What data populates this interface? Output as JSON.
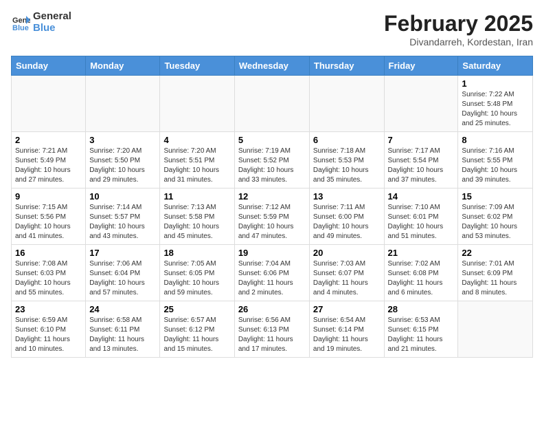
{
  "header": {
    "logo": {
      "general": "General",
      "blue": "Blue"
    },
    "title": "February 2025",
    "subtitle": "Divandarreh, Kordestan, Iran"
  },
  "calendar": {
    "days_of_week": [
      "Sunday",
      "Monday",
      "Tuesday",
      "Wednesday",
      "Thursday",
      "Friday",
      "Saturday"
    ],
    "weeks": [
      [
        {
          "day": "",
          "empty": true
        },
        {
          "day": "",
          "empty": true
        },
        {
          "day": "",
          "empty": true
        },
        {
          "day": "",
          "empty": true
        },
        {
          "day": "",
          "empty": true
        },
        {
          "day": "",
          "empty": true
        },
        {
          "day": "1",
          "sunrise": "7:22 AM",
          "sunset": "5:48 PM",
          "daylight": "10 hours and 25 minutes."
        }
      ],
      [
        {
          "day": "2",
          "sunrise": "7:21 AM",
          "sunset": "5:49 PM",
          "daylight": "10 hours and 27 minutes."
        },
        {
          "day": "3",
          "sunrise": "7:20 AM",
          "sunset": "5:50 PM",
          "daylight": "10 hours and 29 minutes."
        },
        {
          "day": "4",
          "sunrise": "7:20 AM",
          "sunset": "5:51 PM",
          "daylight": "10 hours and 31 minutes."
        },
        {
          "day": "5",
          "sunrise": "7:19 AM",
          "sunset": "5:52 PM",
          "daylight": "10 hours and 33 minutes."
        },
        {
          "day": "6",
          "sunrise": "7:18 AM",
          "sunset": "5:53 PM",
          "daylight": "10 hours and 35 minutes."
        },
        {
          "day": "7",
          "sunrise": "7:17 AM",
          "sunset": "5:54 PM",
          "daylight": "10 hours and 37 minutes."
        },
        {
          "day": "8",
          "sunrise": "7:16 AM",
          "sunset": "5:55 PM",
          "daylight": "10 hours and 39 minutes."
        }
      ],
      [
        {
          "day": "9",
          "sunrise": "7:15 AM",
          "sunset": "5:56 PM",
          "daylight": "10 hours and 41 minutes."
        },
        {
          "day": "10",
          "sunrise": "7:14 AM",
          "sunset": "5:57 PM",
          "daylight": "10 hours and 43 minutes."
        },
        {
          "day": "11",
          "sunrise": "7:13 AM",
          "sunset": "5:58 PM",
          "daylight": "10 hours and 45 minutes."
        },
        {
          "day": "12",
          "sunrise": "7:12 AM",
          "sunset": "5:59 PM",
          "daylight": "10 hours and 47 minutes."
        },
        {
          "day": "13",
          "sunrise": "7:11 AM",
          "sunset": "6:00 PM",
          "daylight": "10 hours and 49 minutes."
        },
        {
          "day": "14",
          "sunrise": "7:10 AM",
          "sunset": "6:01 PM",
          "daylight": "10 hours and 51 minutes."
        },
        {
          "day": "15",
          "sunrise": "7:09 AM",
          "sunset": "6:02 PM",
          "daylight": "10 hours and 53 minutes."
        }
      ],
      [
        {
          "day": "16",
          "sunrise": "7:08 AM",
          "sunset": "6:03 PM",
          "daylight": "10 hours and 55 minutes."
        },
        {
          "day": "17",
          "sunrise": "7:06 AM",
          "sunset": "6:04 PM",
          "daylight": "10 hours and 57 minutes."
        },
        {
          "day": "18",
          "sunrise": "7:05 AM",
          "sunset": "6:05 PM",
          "daylight": "10 hours and 59 minutes."
        },
        {
          "day": "19",
          "sunrise": "7:04 AM",
          "sunset": "6:06 PM",
          "daylight": "11 hours and 2 minutes."
        },
        {
          "day": "20",
          "sunrise": "7:03 AM",
          "sunset": "6:07 PM",
          "daylight": "11 hours and 4 minutes."
        },
        {
          "day": "21",
          "sunrise": "7:02 AM",
          "sunset": "6:08 PM",
          "daylight": "11 hours and 6 minutes."
        },
        {
          "day": "22",
          "sunrise": "7:01 AM",
          "sunset": "6:09 PM",
          "daylight": "11 hours and 8 minutes."
        }
      ],
      [
        {
          "day": "23",
          "sunrise": "6:59 AM",
          "sunset": "6:10 PM",
          "daylight": "11 hours and 10 minutes."
        },
        {
          "day": "24",
          "sunrise": "6:58 AM",
          "sunset": "6:11 PM",
          "daylight": "11 hours and 13 minutes."
        },
        {
          "day": "25",
          "sunrise": "6:57 AM",
          "sunset": "6:12 PM",
          "daylight": "11 hours and 15 minutes."
        },
        {
          "day": "26",
          "sunrise": "6:56 AM",
          "sunset": "6:13 PM",
          "daylight": "11 hours and 17 minutes."
        },
        {
          "day": "27",
          "sunrise": "6:54 AM",
          "sunset": "6:14 PM",
          "daylight": "11 hours and 19 minutes."
        },
        {
          "day": "28",
          "sunrise": "6:53 AM",
          "sunset": "6:15 PM",
          "daylight": "11 hours and 21 minutes."
        },
        {
          "day": "",
          "empty": true
        }
      ]
    ]
  }
}
